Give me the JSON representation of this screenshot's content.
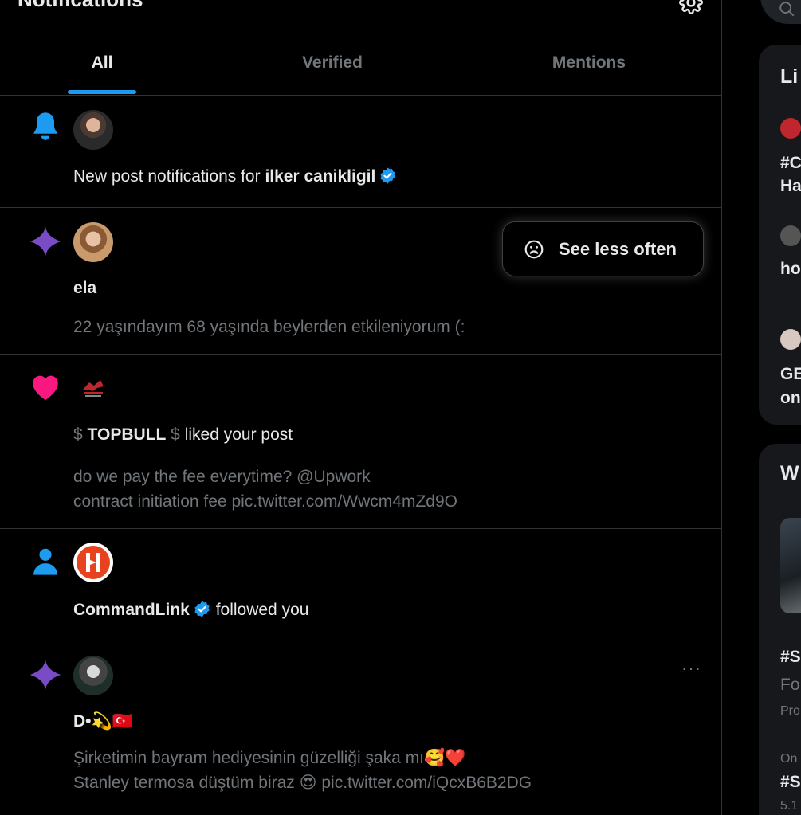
{
  "header": {
    "title": "Notifications"
  },
  "tabs": [
    {
      "label": "All"
    },
    {
      "label": "Verified"
    },
    {
      "label": "Mentions"
    }
  ],
  "notifications": [
    {
      "type": "new-post",
      "prefix": "New post notifications for ",
      "name": "ilker canikligil"
    },
    {
      "type": "recommended",
      "name": "ela",
      "text": "22 yaşındayım 68 yaşında beylerden etkileniyorum (:"
    },
    {
      "type": "like",
      "name_prefix": "$",
      "name": "TOPBULL",
      "name_suffix": "$",
      "action": "liked your post",
      "text_line1": "do we pay the fee everytime? @Upwork",
      "text_line2": "contract initiation fee pic.twitter.com/Wwcm4mZd9O"
    },
    {
      "type": "follow",
      "name": "CommandLink",
      "action": "followed you"
    },
    {
      "type": "recommended",
      "name": "D•💫🇹🇷",
      "text_line1": "Şirketimin bayram hediyesinin güzelliği şaka mı🥰❤️",
      "text_line2": "Stanley termosa düştüm biraz 😍 pic.twitter.com/iQcxB6B2DG",
      "more": "···"
    }
  ],
  "popup": {
    "label": "See less often"
  },
  "sidebar": {
    "live_title": "Li",
    "live_items": [
      {
        "line1": "#C",
        "line2": "Ha"
      },
      {
        "line1": "ho"
      },
      {
        "line1": "GE",
        "line2": "on"
      }
    ],
    "whats_title": "W",
    "trends": [
      {
        "tag": "#S",
        "line1": "Fo",
        "line2": "Pro"
      },
      {
        "context": "On",
        "tag": "#S",
        "count": "5.1"
      }
    ]
  },
  "colors": {
    "accent": "#1d9bf0",
    "like": "#f91880",
    "recommended": "#794bc4",
    "verified": "#1d9bf0"
  }
}
